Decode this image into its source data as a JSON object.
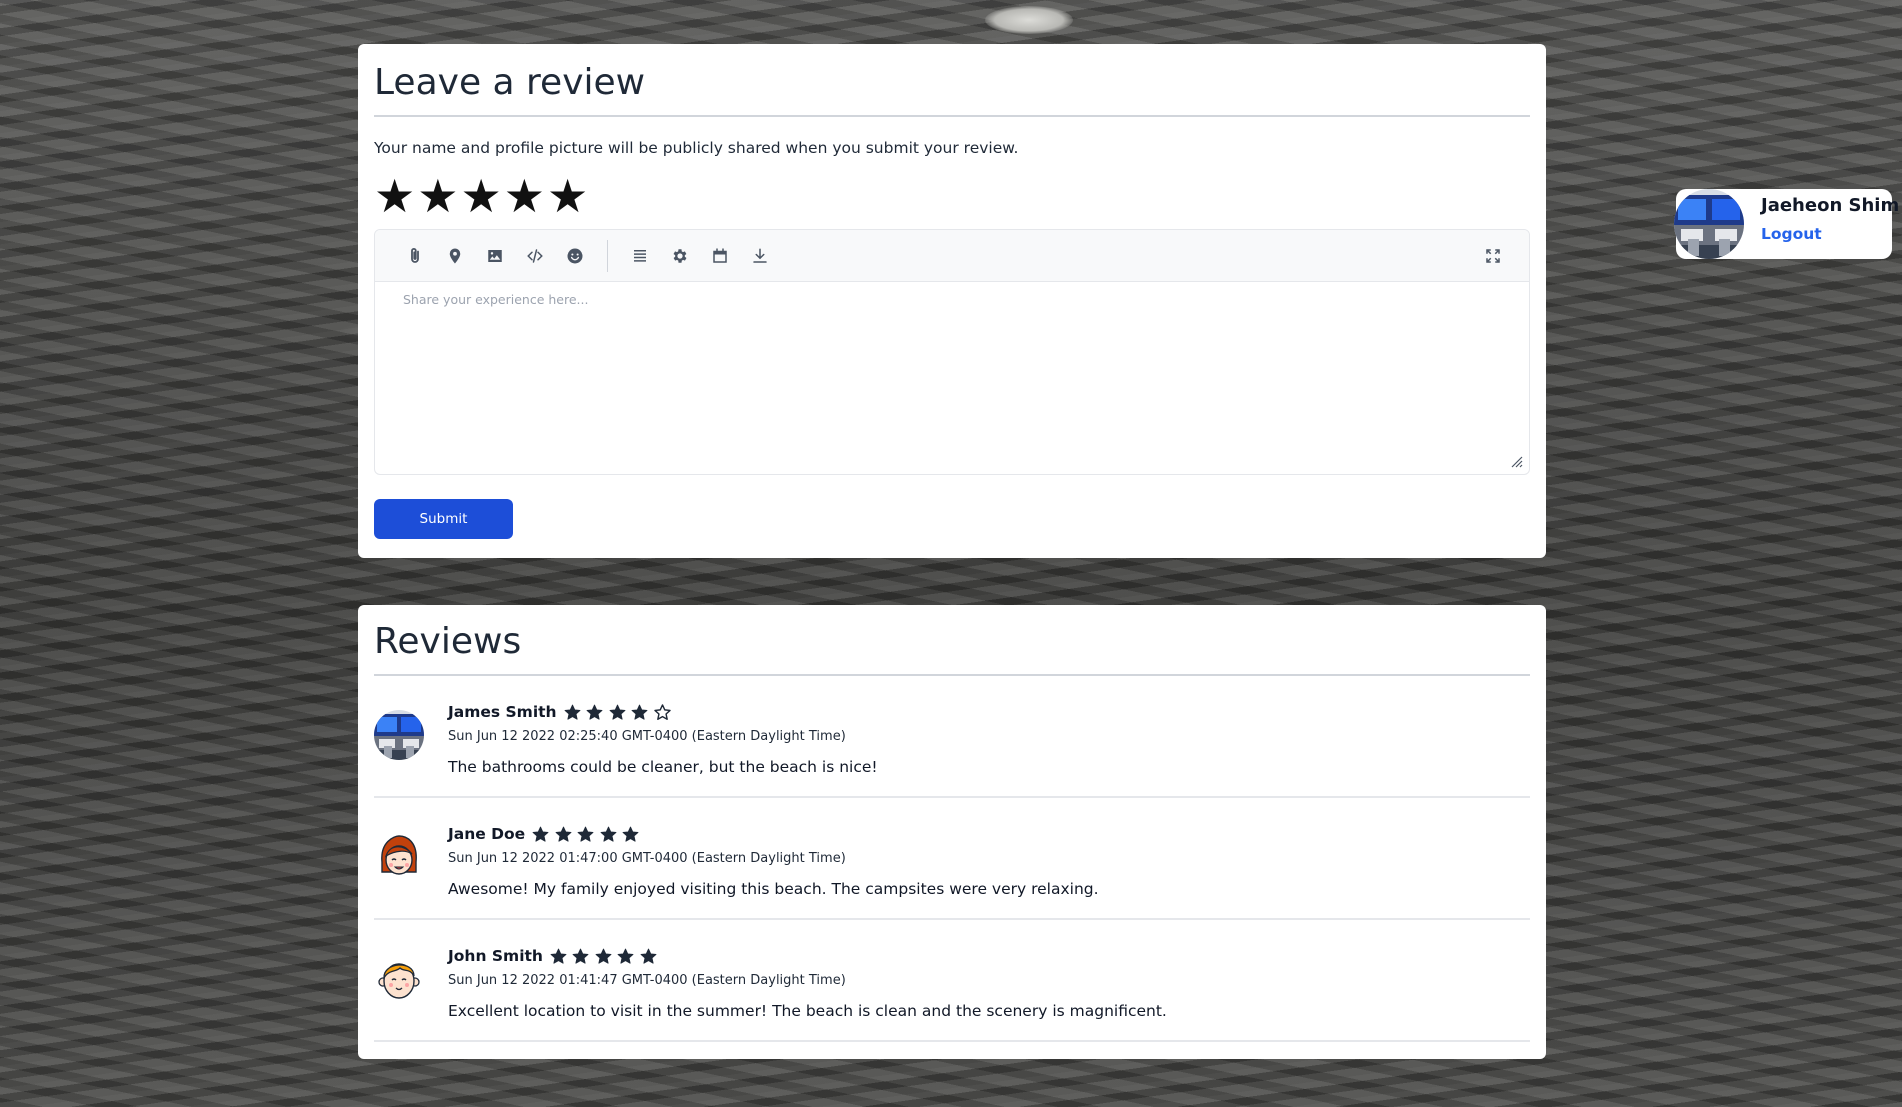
{
  "review_form": {
    "title": "Leave a review",
    "notice": "Your name and profile picture will be publicly shared when you submit your review.",
    "rating_selected": 5,
    "stars": [
      "★",
      "★",
      "★",
      "★",
      "★"
    ],
    "toolbar_icons": [
      "paperclip-icon",
      "map-pin-icon",
      "image-icon",
      "code-icon",
      "smile-icon",
      "list-icon",
      "gear-icon",
      "calendar-icon",
      "download-icon",
      "fullscreen-icon"
    ],
    "textarea_placeholder": "Share your experience here...",
    "textarea_value": "",
    "submit_label": "Submit",
    "submit_color": "#1d4ed8"
  },
  "reviews_section": {
    "title": "Reviews",
    "items": [
      {
        "name": "James Smith",
        "rating": 4,
        "date": "Sun Jun 12 2022 02:25:40 GMT-0400 (Eastern Daylight Time)",
        "text": "The bathrooms could be cleaner, but the beach is nice!",
        "avatar": "computer-workstation-avatar"
      },
      {
        "name": "Jane Doe",
        "rating": 5,
        "date": "Sun Jun 12 2022 01:47:00 GMT-0400 (Eastern Daylight Time)",
        "text": "Awesome! My family enjoyed visiting this beach. The campsites were very relaxing.",
        "avatar": "red-haired-woman-avatar"
      },
      {
        "name": "John Smith",
        "rating": 5,
        "date": "Sun Jun 12 2022 01:41:47 GMT-0400 (Eastern Daylight Time)",
        "text": "Excellent location to visit in the summer! The beach is clean and the scenery is magnificent.",
        "avatar": "blond-man-avatar"
      }
    ]
  },
  "user": {
    "name": "Jaeheon Shim",
    "logout_label": "Logout",
    "link_color": "#2563eb"
  }
}
